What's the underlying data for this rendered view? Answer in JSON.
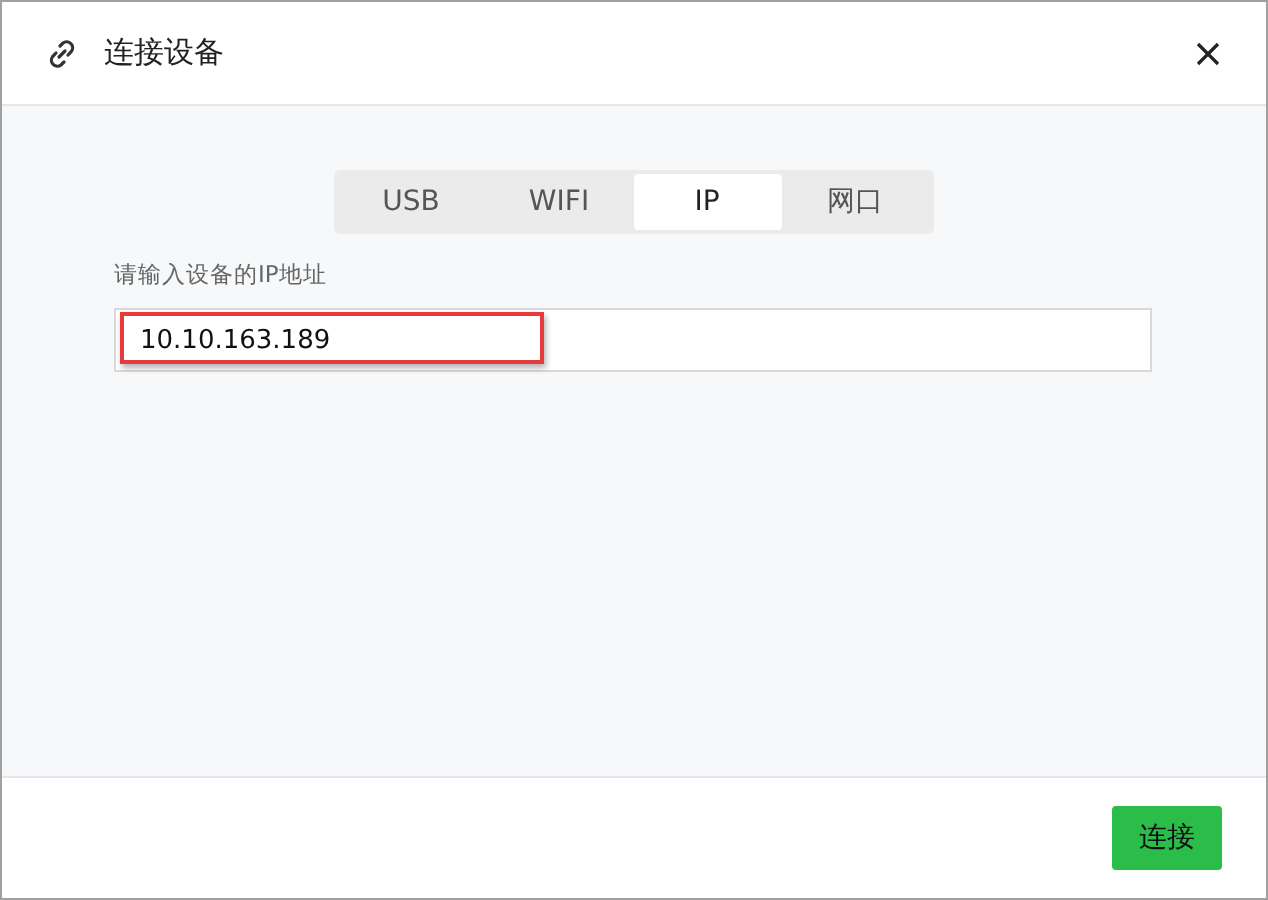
{
  "window": {
    "title": "连接设备"
  },
  "tabs": [
    {
      "label": "USB",
      "selected": false
    },
    {
      "label": "WIFI",
      "selected": false
    },
    {
      "label": "IP",
      "selected": true
    },
    {
      "label": "网口",
      "selected": false
    }
  ],
  "ip_field": {
    "label": "请输入设备的IP地址",
    "value": "10.10.163.189"
  },
  "buttons": [
    "连接"
  ]
}
